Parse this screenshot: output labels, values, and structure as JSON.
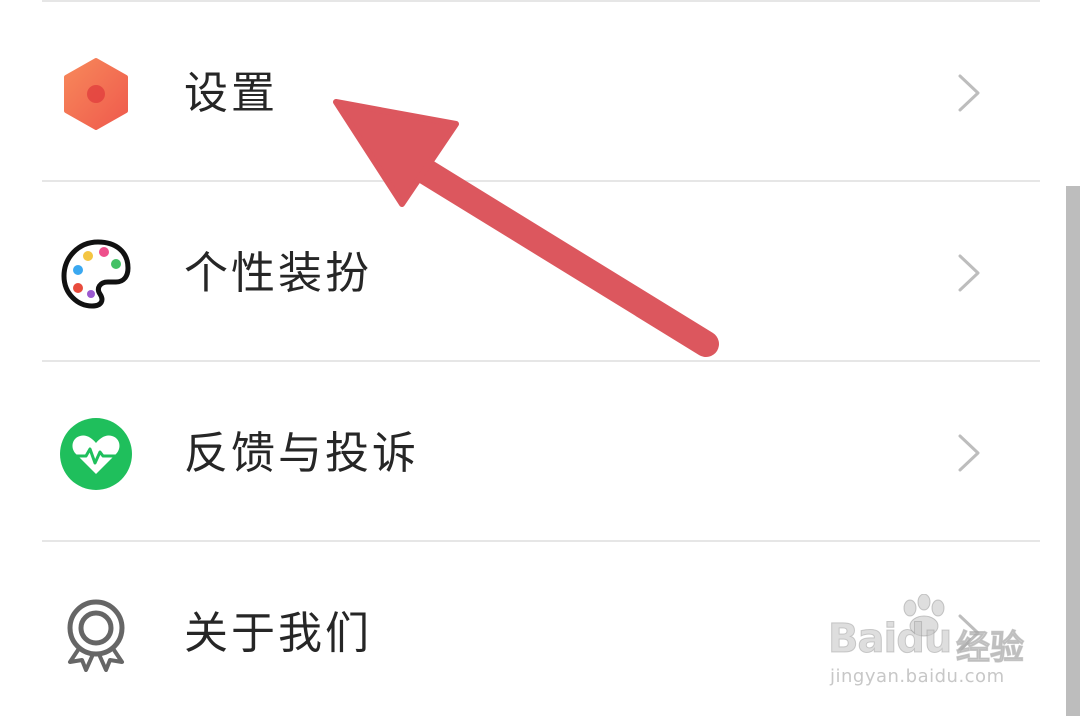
{
  "menu": {
    "items": [
      {
        "label": "设置",
        "icon": "settings-hexagon-icon",
        "icon_color": "#f26d4f"
      },
      {
        "label": "个性装扮",
        "icon": "palette-icon",
        "icon_color": "#111111"
      },
      {
        "label": "反馈与投诉",
        "icon": "heart-pulse-icon",
        "icon_color": "#1fbf5c"
      },
      {
        "label": "关于我们",
        "icon": "award-badge-icon",
        "icon_color": "#666666"
      }
    ]
  },
  "annotation": {
    "arrow_color": "#dc575e",
    "target": "设置"
  },
  "watermark": {
    "brand": "Bai",
    "brand_suffix": "du",
    "product": "经验",
    "url": "jingyan.baidu.com"
  }
}
